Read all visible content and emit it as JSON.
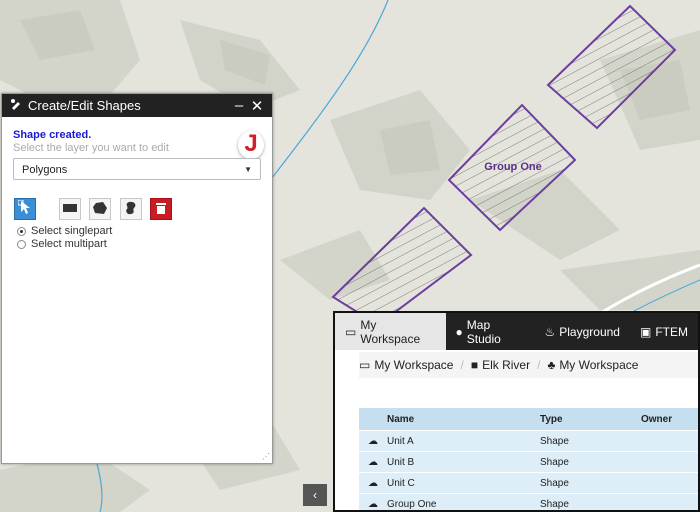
{
  "map": {
    "polygon_label": "Group One",
    "colors": {
      "outline": "#6b3fa0",
      "road": "#4aa6d8",
      "land": "#e4e4dc"
    }
  },
  "edit_panel": {
    "title": "Create/Edit Shapes",
    "minimize_glyph": "–",
    "close_glyph": "✕",
    "status": "Shape created.",
    "hint": "Select the layer you want to edit",
    "logo_letter": "J",
    "layer_select": {
      "value": "Polygons",
      "caret": "▼"
    },
    "tools": [
      {
        "name": "select-tool",
        "icon": "pointer-icon"
      },
      {
        "name": "rectangle-tool",
        "icon": "rectangle-icon"
      },
      {
        "name": "polygon-tool",
        "icon": "polygon-icon"
      },
      {
        "name": "freehand-tool",
        "icon": "freehand-icon"
      },
      {
        "name": "delete-tool",
        "icon": "trash-icon"
      }
    ],
    "options": [
      {
        "label": "Select singlepart",
        "checked": true
      },
      {
        "label": "Select multipart",
        "checked": false
      }
    ]
  },
  "workspace": {
    "tabs": [
      {
        "label": "My Workspace",
        "icon": "window-icon",
        "active": true
      },
      {
        "label": "Map Studio",
        "icon": "globe-icon",
        "active": false
      },
      {
        "label": "Playground",
        "icon": "flame-icon",
        "active": false
      },
      {
        "label": "FTEM",
        "icon": "clipboard-icon",
        "active": false
      }
    ],
    "breadcrumb": [
      {
        "label": "My Workspace",
        "icon": "window-icon"
      },
      {
        "label": "Elk River",
        "icon": "folder-icon"
      },
      {
        "label": "My Workspace",
        "icon": "tree-icon"
      }
    ],
    "columns": [
      "Name",
      "Type",
      "Owner"
    ],
    "rows": [
      {
        "name": "Unit A",
        "type": "Shape",
        "owner": ""
      },
      {
        "name": "Unit B",
        "type": "Shape",
        "owner": ""
      },
      {
        "name": "Unit C",
        "type": "Shape",
        "owner": ""
      },
      {
        "name": "Group One",
        "type": "Shape",
        "owner": ""
      }
    ]
  },
  "pager": {
    "prev_glyph": "‹"
  }
}
